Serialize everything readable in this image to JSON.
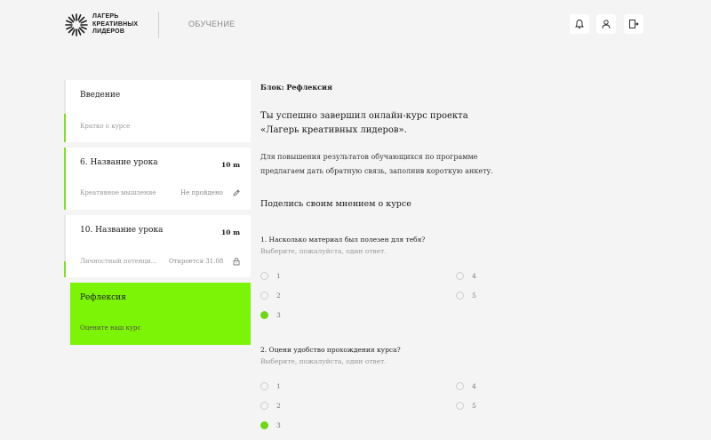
{
  "header": {
    "logo_lines": [
      "ЛАГЕРЬ",
      "КРЕАТИВНЫХ",
      "ЛИДЕРОВ"
    ],
    "nav_label": "ОБУЧЕНИЕ",
    "icons": [
      "bell-icon",
      "user-icon",
      "exit-icon"
    ]
  },
  "sidebar": {
    "intro": {
      "title": "Введение",
      "subtitle": "Кратко о курсе"
    },
    "lesson1": {
      "title": "6. Название урока",
      "time": "10 m",
      "subtitle": "Креативное мышление",
      "status": "Не пройдено"
    },
    "lesson2": {
      "title": "10. Название урока",
      "time": "10 m",
      "subtitle": "Личностный потенци...",
      "status": "Откроется 31.08"
    },
    "reflection": {
      "title": "Рефлексия",
      "subtitle": "Оцените наш курс"
    }
  },
  "main": {
    "block_label": "Блок: Рефлексия",
    "intro_title_line1": "Ты успешно завершил онлайн-курс проекта",
    "intro_title_line2": "«Лагерь креативных лидеров».",
    "intro_text_line1": "Для повышения результатов обучающихся по программе",
    "intro_text_line2": "предлагаем дать обратную связь, заполнив короткую анкету.",
    "feedback_title": "Поделись своим мнением о курсе",
    "questions": [
      {
        "text": "1. Насколько материал был полезен для тебя?",
        "hint": "Выберите, пожалуйста, один ответ.",
        "options": [
          "1",
          "2",
          "3",
          "4",
          "5"
        ],
        "selected": "3"
      },
      {
        "text": "2. Оцени удобство прохождения курса?",
        "hint": "Выберите, пожалуйста, один ответ.",
        "options": [
          "1",
          "2",
          "3",
          "4",
          "5"
        ],
        "selected": "3"
      }
    ]
  },
  "colors": {
    "accent": "#7cf405",
    "radio_checked": "#6fd815",
    "background": "#f4f4f4"
  }
}
